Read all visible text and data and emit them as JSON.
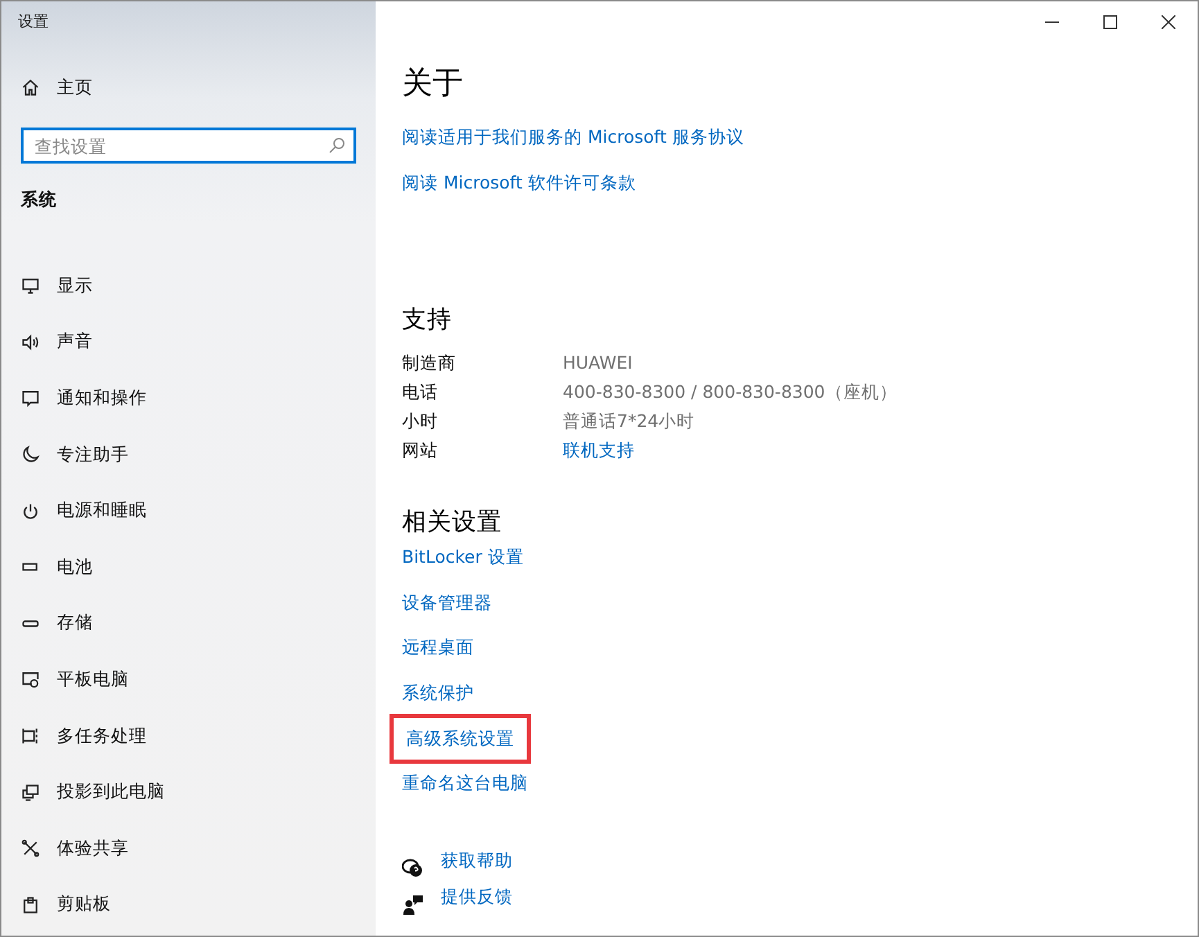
{
  "window": {
    "title": "设置"
  },
  "sidebar": {
    "home": {
      "label": "主页"
    },
    "search": {
      "placeholder": "查找设置"
    },
    "section": "系统",
    "items": [
      {
        "label": "显示"
      },
      {
        "label": "声音"
      },
      {
        "label": "通知和操作"
      },
      {
        "label": "专注助手"
      },
      {
        "label": "电源和睡眠"
      },
      {
        "label": "电池"
      },
      {
        "label": "存储"
      },
      {
        "label": "平板电脑"
      },
      {
        "label": "多任务处理"
      },
      {
        "label": "投影到此电脑"
      },
      {
        "label": "体验共享"
      },
      {
        "label": "剪贴板"
      }
    ]
  },
  "content": {
    "title": "关于",
    "links": [
      {
        "label": "阅读适用于我们服务的 Microsoft 服务协议"
      },
      {
        "label": "阅读 Microsoft 软件许可条款"
      }
    ],
    "support": {
      "title": "支持",
      "rows": [
        {
          "label": "制造商",
          "value": "HUAWEI",
          "kind": "text"
        },
        {
          "label": "电话",
          "value": "400-830-8300 / 800-830-8300（座机）",
          "kind": "text"
        },
        {
          "label": "小时",
          "value": "普通话7*24小时",
          "kind": "text"
        },
        {
          "label": "网站",
          "value": "联机支持",
          "kind": "link"
        }
      ]
    },
    "related": {
      "title": "相关设置",
      "links": [
        {
          "label": "BitLocker 设置",
          "highlighted": false
        },
        {
          "label": "设备管理器",
          "highlighted": false
        },
        {
          "label": "远程桌面",
          "highlighted": false
        },
        {
          "label": "系统保护",
          "highlighted": false
        },
        {
          "label": "高级系统设置",
          "highlighted": true
        },
        {
          "label": "重命名这台电脑",
          "highlighted": false
        }
      ]
    },
    "help": [
      {
        "label": "获取帮助"
      },
      {
        "label": "提供反馈"
      }
    ]
  }
}
